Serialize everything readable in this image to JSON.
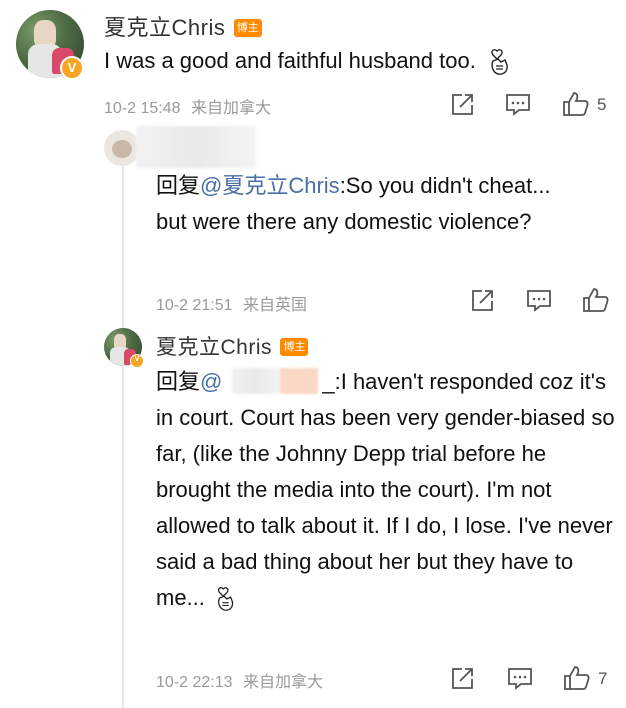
{
  "comment1": {
    "username": "夏克立Chris",
    "badge": "博主",
    "verified_mark": "V",
    "text": "I was a good and faithful husband too.",
    "emoji": "hand-heart-emoji",
    "date": "10-2 15:48",
    "location": "来自加拿大",
    "like_count": "5"
  },
  "reply1": {
    "prefix": "回复",
    "mention": "@夏克立Chris",
    "text": ":So you didn't cheat... but were there any domestic violence?",
    "date": "10-2 21:51",
    "location": "来自英国"
  },
  "reply2": {
    "username": "夏克立Chris",
    "badge": "博主",
    "verified_mark": "V",
    "prefix": "回复",
    "mention": "@",
    "mention_tail": "_",
    "text": ":I haven't responded coz it's in court. Court has been very gender-biased so far, (like the Johnny Depp trial before he brought the media into the court). I'm not allowed to talk about it. If I do, I lose. I've never said a bad thing about her but they have to me...",
    "emoji": "hand-heart-emoji",
    "date": "10-2 22:13",
    "location": "来自加拿大",
    "like_count": "7"
  },
  "colors": {
    "link": "#4a6fa5",
    "badge": "#ff8a00",
    "verified": "#f5a623",
    "meta": "#9a9a9a",
    "icon": "#555555"
  }
}
